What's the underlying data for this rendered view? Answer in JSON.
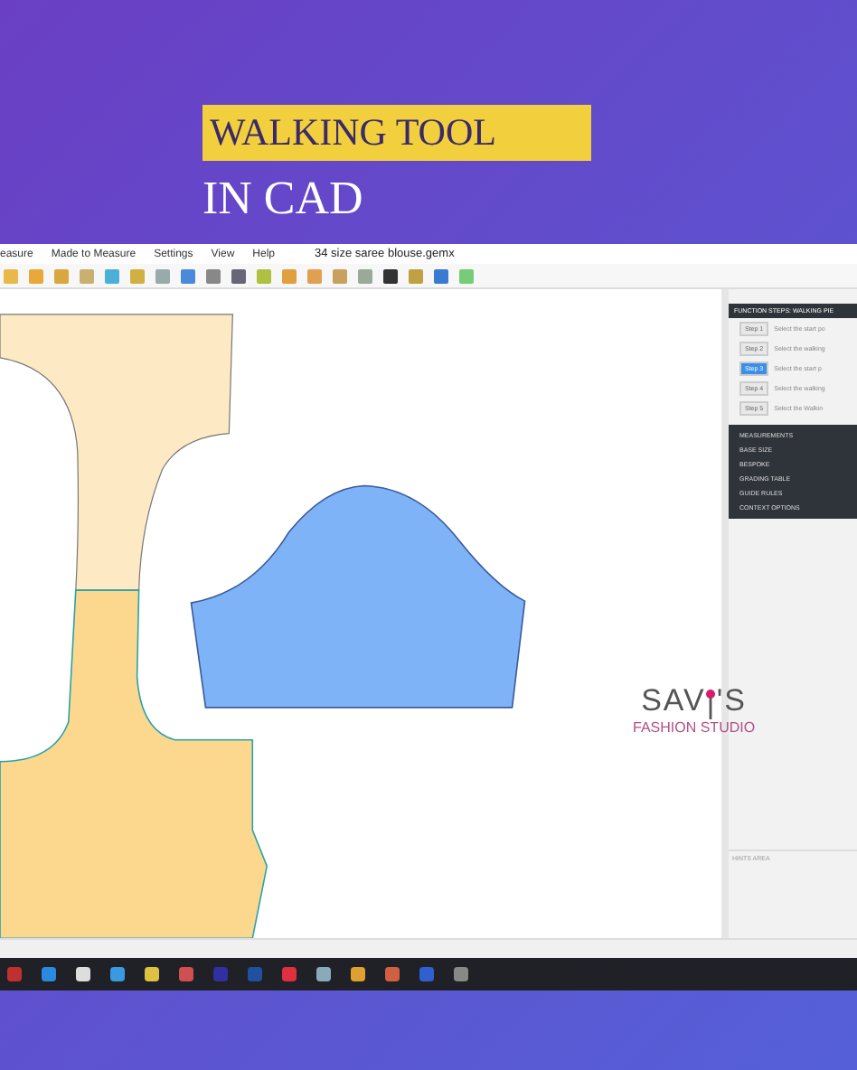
{
  "banner": {
    "title": "WALKING TOOL",
    "subtitle": "IN CAD"
  },
  "menu": {
    "items": [
      "easure",
      "Made to Measure",
      "Settings",
      "View",
      "Help"
    ],
    "document": "34 size saree  blouse.gemx"
  },
  "panel": {
    "header": "FUNCTION STEPS: WALKING PIE",
    "steps": [
      {
        "label": "Step 1",
        "text": "Select the start po",
        "selected": false
      },
      {
        "label": "Step 2",
        "text": "Select the walking",
        "selected": false
      },
      {
        "label": "Step 3",
        "text": "Select the start p",
        "selected": true
      },
      {
        "label": "Step 4",
        "text": "Select the walking",
        "selected": false
      },
      {
        "label": "Step 5",
        "text": "Select the Walkin",
        "selected": false
      }
    ],
    "sections": [
      "MEASUREMENTS",
      "BASE SIZE",
      "BESPOKE",
      "GRADING TABLE",
      "GUIDE RULES",
      "CONTEXT OPTIONS"
    ],
    "hints": "HINTS AREA"
  },
  "logo": {
    "left": "SAV",
    "right": "'S",
    "tagline": "FASHION STUDIO"
  }
}
